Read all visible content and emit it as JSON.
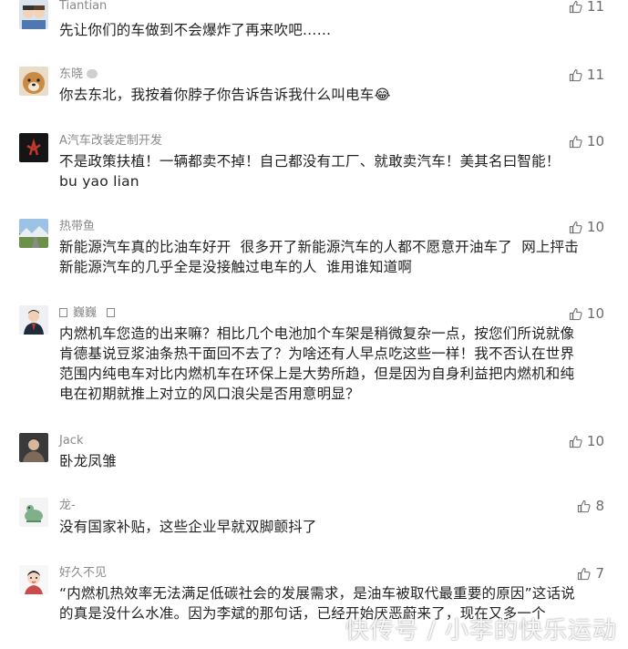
{
  "comments": [
    {
      "name": "Tiantian",
      "likes": "11",
      "text": "先让你们的车做到不会爆炸了再来吹吧……"
    },
    {
      "name": "东晓",
      "likes": "11",
      "text": "你去东北，我按着你脖子你告诉告诉我什么叫电车😂"
    },
    {
      "name": "A汽车改装定制开发",
      "likes": "10",
      "text": "不是政策扶植！一辆都卖不掉！自己都没有工厂、就敢卖汽车！美其名曰智能！\nbu yao lian"
    },
    {
      "name": "热带鱼",
      "likes": "10",
      "text": "新能源汽车真的比油车好开  很多开了新能源汽车的人都不愿意开油车了  网上抨击\n新能源汽车的几乎全是没接触过电车的人  谁用谁知道啊"
    },
    {
      "name": "巍巍",
      "likes": "10",
      "text": "内燃机车您造的出来嘛？相比几个电池加个车架是稍微复杂一点，按您们所说就像\n肯德基说豆浆油条热干面回不去了？为啥还有人早点吃这些一样！我不否认在世界\n范围内纯电车对比内燃机车在环保上是大势所趋，但是因为自身利益把内燃机和纯\n电在初期就推上对立的风口浪尖是否用意明显？"
    },
    {
      "name": "Jack",
      "likes": "10",
      "text": "卧龙凤雏"
    },
    {
      "name": "龙-",
      "likes": "8",
      "text": "没有国家补贴，这些企业早就双脚颤抖了"
    },
    {
      "name": "好久不见",
      "likes": "7",
      "text": "“内燃机热效率无法满足低碳社会的发展需求，是油车被取代最重要的原因”这话说\n的真是没什么水准。因为李斌的那句话，已经开始厌恶蔚来了，现在又多一个"
    }
  ],
  "watermark": "快传号 / 小李的快乐运动",
  "colors": {
    "name": "#8a8a8a",
    "text": "#222222",
    "like": "#6b6b6b"
  }
}
